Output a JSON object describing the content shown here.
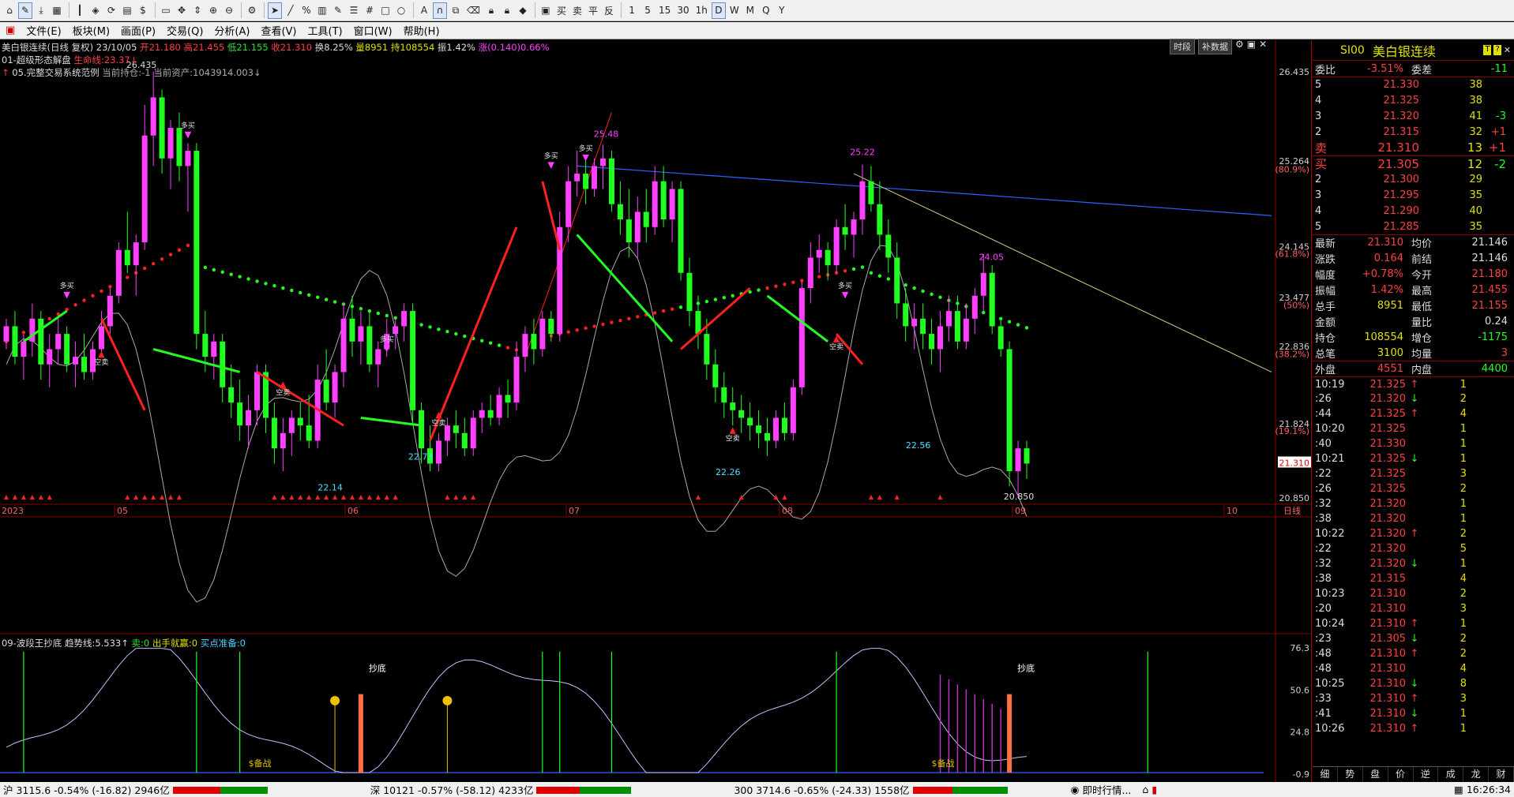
{
  "toolbar": {
    "icons": [
      "home-icon",
      "pen-icon",
      "download-icon",
      "grid-icon",
      "bars-icon",
      "diamond-icon",
      "refresh-icon",
      "disk-icon",
      "dollar-icon",
      "screen-icon",
      "move-icon",
      "zoom-fit-icon",
      "zoom-in-icon",
      "zoom-out-icon",
      "gear-icon",
      "cursor-icon",
      "line-icon",
      "percent-icon",
      "ruler-icon",
      "pen-icon",
      "list-icon",
      "hash-icon",
      "rect-icon",
      "circle-icon",
      "text-A-icon",
      "magnet-icon",
      "copy-icon",
      "delete-icon",
      "lock-icon",
      "lock-icon",
      "color-icon",
      "save-icon"
    ],
    "text_buttons": [
      "买",
      "卖",
      "平",
      "反"
    ],
    "periods": [
      "1",
      "5",
      "15",
      "30",
      "1h",
      "D",
      "W",
      "M",
      "Q",
      "Y"
    ]
  },
  "menu": [
    "文件(E)",
    "板块(M)",
    "画面(P)",
    "交易(Q)",
    "分析(A)",
    "查看(V)",
    "工具(T)",
    "窗口(W)",
    "帮助(H)"
  ],
  "chart_header": {
    "line1": {
      "name": "美白银连续(日线 复权) 23/10/05",
      "open": "开21.180",
      "high": "高21.455",
      "low": "低21.155",
      "close": "收21.310",
      "turnover": "换8.25%",
      "vol": "量8951",
      "oi": "持108554",
      "amp": "振1.42%",
      "chg": "涨(0.140)0.66%"
    },
    "line2": {
      "name": "01-超级形态解盘",
      "life": "生命线:23.37↓"
    },
    "line3": {
      "name": "05.完整交易系统范例",
      "pos": "当前持仓:-1",
      "asset": "当前资产:1043914.003↓"
    },
    "btn_period": "时段",
    "btn_adj": "补数据"
  },
  "chart_data": {
    "type": "candlestick",
    "price_axis": [
      "26.435",
      "25.264",
      "(80.9%)",
      "24.145",
      "(61.8%)",
      "23.477",
      "(50%)",
      "22.836",
      "(38.2%)",
      "21.824",
      "(19.1%)",
      "21.310",
      "20.850"
    ],
    "date_axis": [
      "2023",
      "05",
      "06",
      "07",
      "08",
      "09",
      "10",
      "日线"
    ],
    "annotations": [
      "26.435",
      "25.48",
      "25.22",
      "24.05",
      "22.73",
      "22.14",
      "22.26",
      "22.56",
      "20.850"
    ],
    "signal_labels": [
      "多买",
      "空卖"
    ],
    "ylim": [
      20.85,
      26.435
    ],
    "candles": [
      [
        22.9,
        23.2,
        22.8,
        23.1
      ],
      [
        23.1,
        23.3,
        22.6,
        22.7
      ],
      [
        22.7,
        23.0,
        22.4,
        22.9
      ],
      [
        22.9,
        23.4,
        22.7,
        23.2
      ],
      [
        23.2,
        23.3,
        22.4,
        22.6
      ],
      [
        22.6,
        23.0,
        22.3,
        22.8
      ],
      [
        22.8,
        23.2,
        22.6,
        23.0
      ],
      [
        23.0,
        23.1,
        22.5,
        22.6
      ],
      [
        22.6,
        22.9,
        22.3,
        22.7
      ],
      [
        22.7,
        23.0,
        22.4,
        22.5
      ],
      [
        22.5,
        22.9,
        22.4,
        22.8
      ],
      [
        22.8,
        23.3,
        22.7,
        23.1
      ],
      [
        23.1,
        23.6,
        23.0,
        23.5
      ],
      [
        23.5,
        24.2,
        23.4,
        24.1
      ],
      [
        24.1,
        24.6,
        23.8,
        23.9
      ],
      [
        23.9,
        24.3,
        23.5,
        24.2
      ],
      [
        24.2,
        26.0,
        24.1,
        25.6
      ],
      [
        25.6,
        26.435,
        25.2,
        26.1
      ],
      [
        26.1,
        26.2,
        25.1,
        25.3
      ],
      [
        25.3,
        25.8,
        24.9,
        25.7
      ],
      [
        25.7,
        25.9,
        25.0,
        25.2
      ],
      [
        25.2,
        25.5,
        24.6,
        25.4
      ],
      [
        25.4,
        25.5,
        22.8,
        23.0
      ],
      [
        23.0,
        23.3,
        22.5,
        22.7
      ],
      [
        22.7,
        23.0,
        22.4,
        22.9
      ],
      [
        22.9,
        23.0,
        22.1,
        22.3
      ],
      [
        22.3,
        22.6,
        21.9,
        22.1
      ],
      [
        22.1,
        22.4,
        21.6,
        21.8
      ],
      [
        21.8,
        22.2,
        21.5,
        22.0
      ],
      [
        22.0,
        22.6,
        21.8,
        22.5
      ],
      [
        22.5,
        22.6,
        21.7,
        21.9
      ],
      [
        21.9,
        22.1,
        21.3,
        21.5
      ],
      [
        21.5,
        21.9,
        21.2,
        21.7
      ],
      [
        21.7,
        22.0,
        21.4,
        21.9
      ],
      [
        21.9,
        22.1,
        21.6,
        21.8
      ],
      [
        21.8,
        22.2,
        21.5,
        21.6
      ],
      [
        21.6,
        22.6,
        21.5,
        22.4
      ],
      [
        22.4,
        22.8,
        22.0,
        22.1
      ],
      [
        22.1,
        22.6,
        21.9,
        22.5
      ],
      [
        22.5,
        23.4,
        22.3,
        23.2
      ],
      [
        23.2,
        23.5,
        22.7,
        22.9
      ],
      [
        22.9,
        23.3,
        22.6,
        23.1
      ],
      [
        23.1,
        23.3,
        22.5,
        22.6
      ],
      [
        22.6,
        22.9,
        22.3,
        22.8
      ],
      [
        22.8,
        23.2,
        22.7,
        23.0
      ],
      [
        23.0,
        23.2,
        22.8,
        23.1
      ],
      [
        23.1,
        23.4,
        22.9,
        23.3
      ],
      [
        23.3,
        23.4,
        21.8,
        22.0
      ],
      [
        22.0,
        22.1,
        21.3,
        21.5
      ],
      [
        21.5,
        21.8,
        21.2,
        21.3
      ],
      [
        21.3,
        21.7,
        21.2,
        21.6
      ],
      [
        21.6,
        21.9,
        21.4,
        21.8
      ],
      [
        21.8,
        22.0,
        21.5,
        21.7
      ],
      [
        21.7,
        21.9,
        21.4,
        21.5
      ],
      [
        21.5,
        22.0,
        21.4,
        21.9
      ],
      [
        21.9,
        22.1,
        21.7,
        22.0
      ],
      [
        22.0,
        22.2,
        21.8,
        21.9
      ],
      [
        21.9,
        22.3,
        21.8,
        22.2
      ],
      [
        22.2,
        22.4,
        21.9,
        22.1
      ],
      [
        22.1,
        22.9,
        22.0,
        22.7
      ],
      [
        22.7,
        23.1,
        22.5,
        23.0
      ],
      [
        23.0,
        23.2,
        22.6,
        22.8
      ],
      [
        22.8,
        23.3,
        22.7,
        23.2
      ],
      [
        23.2,
        23.3,
        22.9,
        23.0
      ],
      [
        23.0,
        24.6,
        22.9,
        24.4
      ],
      [
        24.4,
        25.2,
        24.2,
        25.0
      ],
      [
        25.0,
        25.4,
        24.8,
        25.1
      ],
      [
        25.1,
        25.3,
        24.7,
        24.9
      ],
      [
        24.9,
        25.3,
        24.8,
        25.2
      ],
      [
        25.2,
        25.48,
        24.9,
        25.3
      ],
      [
        25.3,
        25.4,
        24.6,
        24.7
      ],
      [
        24.7,
        25.0,
        24.3,
        24.5
      ],
      [
        24.5,
        24.9,
        24.0,
        24.2
      ],
      [
        24.2,
        24.8,
        24.0,
        24.6
      ],
      [
        24.6,
        24.9,
        24.2,
        24.4
      ],
      [
        24.4,
        25.2,
        24.3,
        25.0
      ],
      [
        25.0,
        25.2,
        24.4,
        24.5
      ],
      [
        24.5,
        25.0,
        24.2,
        24.9
      ],
      [
        24.9,
        25.0,
        23.7,
        23.8
      ],
      [
        23.8,
        24.0,
        23.1,
        23.3
      ],
      [
        23.3,
        23.5,
        22.8,
        23.0
      ],
      [
        23.0,
        23.2,
        22.4,
        22.6
      ],
      [
        22.6,
        22.8,
        22.1,
        22.3
      ],
      [
        22.3,
        22.5,
        21.9,
        22.1
      ],
      [
        22.1,
        22.3,
        21.8,
        22.0
      ],
      [
        22.0,
        22.2,
        21.7,
        21.9
      ],
      [
        21.9,
        22.1,
        21.6,
        21.8
      ],
      [
        21.8,
        22.0,
        21.5,
        21.7
      ],
      [
        21.7,
        21.9,
        21.4,
        21.6
      ],
      [
        21.6,
        22.0,
        21.5,
        21.9
      ],
      [
        21.9,
        22.1,
        21.6,
        21.7
      ],
      [
        21.7,
        22.4,
        21.6,
        22.3
      ],
      [
        22.3,
        23.7,
        22.2,
        23.6
      ],
      [
        23.6,
        24.2,
        23.4,
        24.0
      ],
      [
        24.0,
        24.3,
        23.8,
        24.1
      ],
      [
        24.1,
        24.2,
        23.7,
        23.9
      ],
      [
        23.9,
        24.5,
        23.8,
        24.4
      ],
      [
        24.4,
        24.7,
        24.1,
        24.3
      ],
      [
        24.3,
        24.6,
        24.0,
        24.5
      ],
      [
        24.5,
        25.22,
        24.3,
        25.0
      ],
      [
        25.0,
        25.2,
        24.6,
        24.7
      ],
      [
        24.7,
        25.0,
        24.1,
        24.3
      ],
      [
        24.3,
        24.5,
        23.8,
        24.0
      ],
      [
        24.0,
        24.2,
        23.2,
        23.4
      ],
      [
        23.4,
        23.6,
        22.9,
        23.1
      ],
      [
        23.1,
        23.4,
        22.8,
        23.2
      ],
      [
        23.2,
        23.4,
        22.8,
        23.0
      ],
      [
        23.0,
        23.2,
        22.6,
        22.8
      ],
      [
        22.8,
        23.3,
        22.5,
        23.1
      ],
      [
        23.1,
        23.5,
        22.9,
        23.3
      ],
      [
        23.3,
        23.5,
        22.8,
        22.9
      ],
      [
        22.9,
        23.4,
        22.8,
        23.2
      ],
      [
        23.2,
        23.6,
        23.0,
        23.5
      ],
      [
        23.5,
        24.05,
        23.3,
        23.8
      ],
      [
        23.8,
        23.9,
        23.0,
        23.1
      ],
      [
        23.1,
        23.2,
        22.7,
        22.8
      ],
      [
        22.8,
        22.9,
        21.0,
        21.2
      ],
      [
        21.2,
        21.6,
        20.85,
        21.5
      ],
      [
        21.5,
        21.6,
        21.1,
        21.3
      ]
    ]
  },
  "sub_header": {
    "name": "09-波段王抄底",
    "trend": "趋势线:5.533↑",
    "sell": "卖:0",
    "shot": "出手就赢:0",
    "buy": "买点准备:0"
  },
  "sub_axis": [
    "76.3",
    "50.6",
    "24.8",
    "-0.9"
  ],
  "sub_labels": [
    "抄底",
    "抄底",
    "$备战",
    "$备战",
    "$备战"
  ],
  "quote": {
    "code": "SI00",
    "name": "美白银连续",
    "wb": {
      "k": "委比",
      "v": "-3.51%",
      "k2": "委差",
      "v2": "-11"
    },
    "asks": [
      [
        "5",
        "21.330",
        "38",
        ""
      ],
      [
        "4",
        "21.325",
        "38",
        ""
      ],
      [
        "3",
        "21.320",
        "41",
        "-3"
      ],
      [
        "2",
        "21.315",
        "32",
        "+1"
      ],
      [
        "卖",
        "21.310",
        "13",
        "+1"
      ]
    ],
    "bids": [
      [
        "买",
        "21.305",
        "12",
        "-2"
      ],
      [
        "2",
        "21.300",
        "29",
        ""
      ],
      [
        "3",
        "21.295",
        "35",
        ""
      ],
      [
        "4",
        "21.290",
        "40",
        ""
      ],
      [
        "5",
        "21.285",
        "35",
        ""
      ]
    ],
    "stats": [
      [
        "最新",
        "21.310",
        "均价",
        "21.146"
      ],
      [
        "涨跌",
        "0.164",
        "前结",
        "21.146"
      ],
      [
        "幅度",
        "+0.78%",
        "今开",
        "21.180"
      ],
      [
        "振幅",
        "1.42%",
        "最高",
        "21.455"
      ],
      [
        "总手",
        "8951",
        "最低",
        "21.155"
      ],
      [
        "金额",
        "",
        "量比",
        "0.24"
      ],
      [
        "持仓",
        "108554",
        "增仓",
        "-1175"
      ],
      [
        "总笔",
        "3100",
        "均量",
        "3"
      ]
    ],
    "outer": {
      "k": "外盘",
      "v": "4551",
      "k2": "内盘",
      "v2": "4400"
    },
    "ticks": [
      [
        "10:19",
        "21.325",
        "↑",
        "1"
      ],
      [
        ":26",
        "21.320",
        "↓",
        "2"
      ],
      [
        ":44",
        "21.325",
        "↑",
        "4"
      ],
      [
        "10:20",
        "21.325",
        "",
        "1"
      ],
      [
        ":40",
        "21.330",
        "",
        "1"
      ],
      [
        "10:21",
        "21.325",
        "↓",
        "1"
      ],
      [
        ":22",
        "21.325",
        "",
        "3"
      ],
      [
        ":26",
        "21.325",
        "",
        "2"
      ],
      [
        ":32",
        "21.320",
        "",
        "1"
      ],
      [
        ":38",
        "21.320",
        "",
        "1"
      ],
      [
        "10:22",
        "21.320",
        "↑",
        "2"
      ],
      [
        ":22",
        "21.320",
        "",
        "5"
      ],
      [
        ":32",
        "21.320",
        "↓",
        "1"
      ],
      [
        ":38",
        "21.315",
        "",
        "4"
      ],
      [
        "10:23",
        "21.310",
        "",
        "2"
      ],
      [
        ":20",
        "21.310",
        "",
        "3"
      ],
      [
        "10:24",
        "21.310",
        "↑",
        "1"
      ],
      [
        ":23",
        "21.305",
        "↓",
        "2"
      ],
      [
        ":48",
        "21.310",
        "↑",
        "2"
      ],
      [
        ":48",
        "21.310",
        "",
        "4"
      ],
      [
        "10:25",
        "21.310",
        "↓",
        "8"
      ],
      [
        ":33",
        "21.310",
        "↑",
        "3"
      ],
      [
        ":41",
        "21.310",
        "↓",
        "1"
      ],
      [
        "10:26",
        "21.310",
        "↑",
        "1"
      ]
    ]
  },
  "bottom_tabs": [
    "细",
    "势",
    "盘",
    "价",
    "逆",
    "成",
    "龙",
    "财"
  ],
  "status": {
    "sh": "沪 3115.6 -0.54% (-16.82) 2946亿",
    "sz": "深 10121 -0.57% (-58.12) 4233亿",
    "hs": "300 3714.6 -0.65% (-24.33) 1558亿",
    "live": "即时行情...",
    "time": "16:26:34"
  }
}
